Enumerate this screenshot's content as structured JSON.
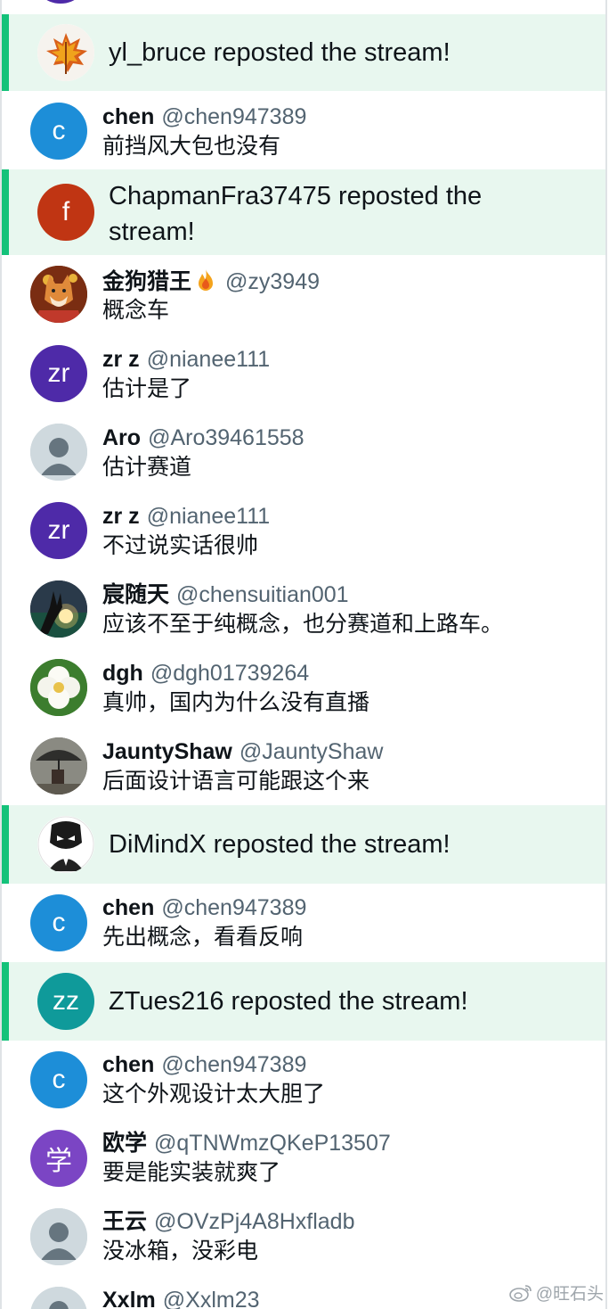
{
  "colors": {
    "accent": "#14c27a",
    "repost_bg": "#e8f7ef",
    "handle": "#536471",
    "text": "#0f1419"
  },
  "reposts": [
    {
      "text": "yl_bruce reposted the stream!",
      "avatar": "autumn-leaf-image"
    },
    {
      "text": "ChapmanFra37475 reposted the stream!",
      "avatar_letter": "f",
      "avatar_color": "#c03513"
    },
    {
      "text": "DiMindX reposted the stream!",
      "avatar": "masked-figure-image"
    },
    {
      "text": "ZTues216 reposted the stream!",
      "avatar_letter": "zz",
      "avatar_color": "#0f9a9a"
    }
  ],
  "comments": [
    {
      "name": "chen",
      "handle": "@chen947389",
      "text": "前挡风大包也没有",
      "avatar_letter": "c",
      "avatar_color": "#1d8ed8"
    },
    {
      "name": "金狗猎王",
      "handle": "@zy3949",
      "text": "概念车",
      "avatar": "shiba-dog-image",
      "name_emoji": "fire-icon"
    },
    {
      "name": "zr z",
      "handle": "@nianee111",
      "text": "估计是了",
      "avatar_letter": "zr",
      "avatar_color": "#4e2aa8"
    },
    {
      "name": "Aro",
      "handle": "@Aro39461558",
      "text": "估计赛道",
      "avatar": "default-person-icon"
    },
    {
      "name": "zr z",
      "handle": "@nianee111",
      "text": "不过说实话很帅",
      "avatar_letter": "zr",
      "avatar_color": "#4e2aa8"
    },
    {
      "name": "宸随天",
      "handle": "@chensuitian001",
      "text": "应该不至于纯概念，也分赛道和上路车。",
      "avatar": "hand-sunset-image"
    },
    {
      "name": "dgh",
      "handle": "@dgh01739264",
      "text": "真帅，国内为什么没有直播",
      "avatar": "white-flower-image"
    },
    {
      "name": "JauntyShaw",
      "handle": "@JauntyShaw",
      "text": "后面设计语言可能跟这个来",
      "avatar": "umbrella-photo-image"
    },
    {
      "name": "chen",
      "handle": "@chen947389",
      "text": "先出概念，看看反响",
      "avatar_letter": "c",
      "avatar_color": "#1d8ed8"
    },
    {
      "name": "chen",
      "handle": "@chen947389",
      "text": "这个外观设计太大胆了",
      "avatar_letter": "c",
      "avatar_color": "#1d8ed8"
    },
    {
      "name": "欧学",
      "handle": "@qTNWmzQKeP13507",
      "text": "要是能实装就爽了",
      "avatar_letter": "学",
      "avatar_color": "#7b45c4"
    },
    {
      "name": "王云",
      "handle": "@OVzPj4A8Hxfladb",
      "text": "没冰箱，没彩电",
      "avatar": "default-person-icon"
    },
    {
      "name": "Xxlm",
      "handle": "@Xxlm23",
      "text": "",
      "avatar": "default-person-icon"
    }
  ],
  "watermark": {
    "text": "@旺石头",
    "icon": "weibo-icon"
  }
}
